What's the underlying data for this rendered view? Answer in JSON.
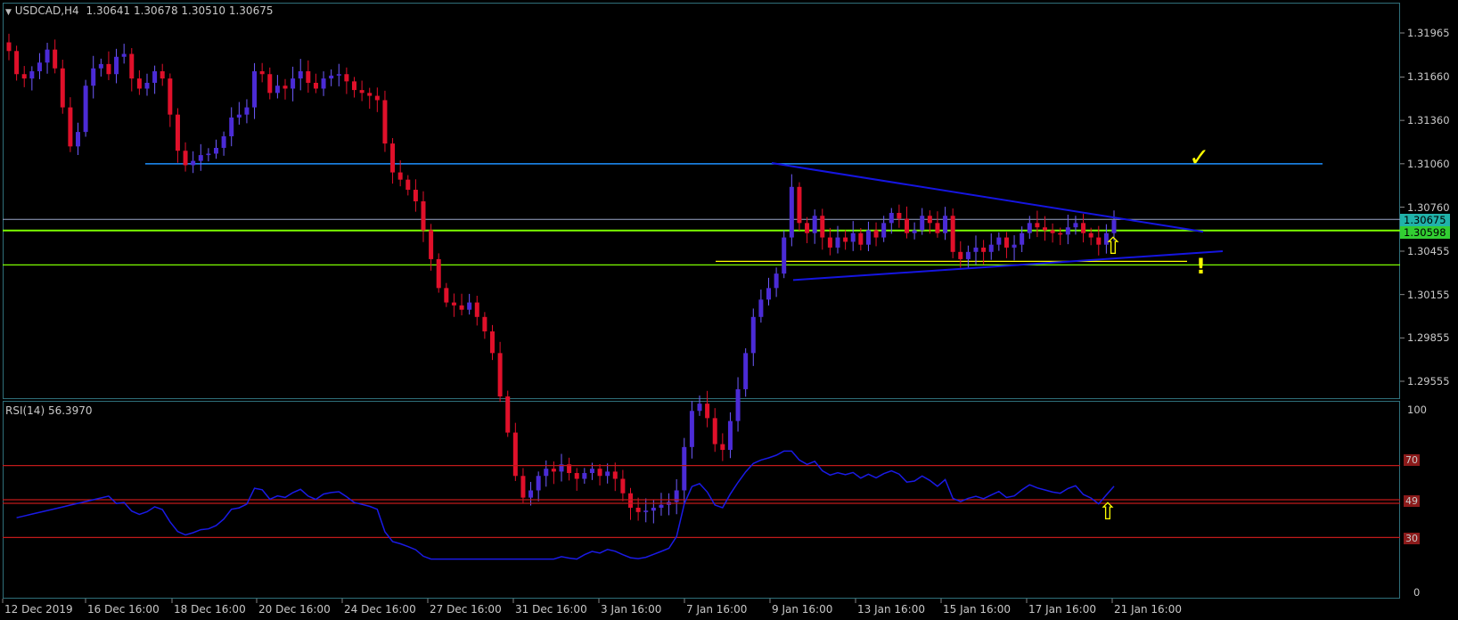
{
  "header": {
    "symbol": "USDCAD,H4",
    "ohlc": "1.30641 1.30678 1.30510 1.30675",
    "menu_icon": "triangle-down-icon"
  },
  "price_axis": {
    "labels": [
      "1.31965",
      "1.31660",
      "1.31360",
      "1.31060",
      "1.30760",
      "1.30455",
      "1.30155",
      "1.29855",
      "1.29555"
    ],
    "current_price": "1.30675",
    "level_price": "1.30598"
  },
  "rsi": {
    "title": "RSI(14) 56.3970",
    "axis": [
      "100",
      "0"
    ],
    "levels": [
      "70",
      "49",
      "30"
    ]
  },
  "time_axis": [
    "12 Dec 2019",
    "16 Dec 16:00",
    "18 Dec 16:00",
    "20 Dec 16:00",
    "24 Dec 16:00",
    "27 Dec 16:00",
    "31 Dec 16:00",
    "3 Jan 16:00",
    "7 Jan 16:00",
    "9 Jan 16:00",
    "13 Jan 16:00",
    "15 Jan 16:00",
    "17 Jan 16:00",
    "21 Jan 16:00"
  ],
  "annotations": {
    "check": "✓",
    "up_arrow": "⇧",
    "exclamation": "!"
  },
  "colors": {
    "bull": "#4b2bd6",
    "bear": "#e0102a",
    "wick_bull": "#6f5cff",
    "resistance": "#1e90ff",
    "support_green": "#7cfc00",
    "yellow": "#ffff00",
    "trendline": "#1515e0",
    "rsi_line": "#1a1ae6",
    "rsi_level": "#c01a1a",
    "current_price_tag": "#20b2aa",
    "level_price_tag": "#32cd32"
  },
  "chart_data": {
    "type": "candlestick",
    "symbol": "USDCAD",
    "timeframe": "H4",
    "ylim": [
      1.2945,
      1.3232
    ],
    "close_path": [
      1.3184,
      1.3168,
      1.3165,
      1.317,
      1.3176,
      1.3185,
      1.3172,
      1.3145,
      1.3118,
      1.3128,
      1.316,
      1.3172,
      1.3175,
      1.3168,
      1.318,
      1.3182,
      1.3165,
      1.3158,
      1.3162,
      1.317,
      1.3165,
      1.314,
      1.3115,
      1.3105,
      1.3108,
      1.3112,
      1.3113,
      1.3117,
      1.3125,
      1.3138,
      1.314,
      1.3145,
      1.317,
      1.3168,
      1.3155,
      1.316,
      1.3158,
      1.3165,
      1.317,
      1.3162,
      1.3158,
      1.3165,
      1.3167,
      1.3168,
      1.3163,
      1.3157,
      1.3155,
      1.3153,
      1.315,
      1.312,
      1.31,
      1.3095,
      1.3088,
      1.308,
      1.306,
      1.304,
      1.302,
      1.301,
      1.3008,
      1.3005,
      1.301,
      1.3,
      1.299,
      1.2975,
      1.2945,
      1.292,
      1.289,
      1.2875,
      1.288,
      1.289,
      1.2895,
      1.2893,
      1.2898,
      1.2892,
      1.2888,
      1.2892,
      1.2895,
      1.289,
      1.2893,
      1.2888,
      1.2878,
      1.2868,
      1.2865,
      1.2866,
      1.2868,
      1.287,
      1.2872,
      1.288,
      1.291,
      1.2935,
      1.294,
      1.293,
      1.2912,
      1.2908,
      1.2928,
      1.295,
      1.2975,
      1.3,
      1.3012,
      1.302,
      1.303,
      1.3055,
      1.309,
      1.3065,
      1.3058,
      1.307,
      1.3055,
      1.3048,
      1.3055,
      1.3052,
      1.3058,
      1.305,
      1.306,
      1.3055,
      1.3065,
      1.3072,
      1.3068,
      1.3058,
      1.306,
      1.307,
      1.3065,
      1.3058,
      1.307,
      1.3045,
      1.304,
      1.3045,
      1.3048,
      1.3045,
      1.305,
      1.3055,
      1.3048,
      1.305,
      1.3058,
      1.3065,
      1.3062,
      1.306,
      1.3058,
      1.3057,
      1.3062,
      1.3065,
      1.3058,
      1.3055,
      1.305,
      1.3058,
      1.3067
    ]
  }
}
